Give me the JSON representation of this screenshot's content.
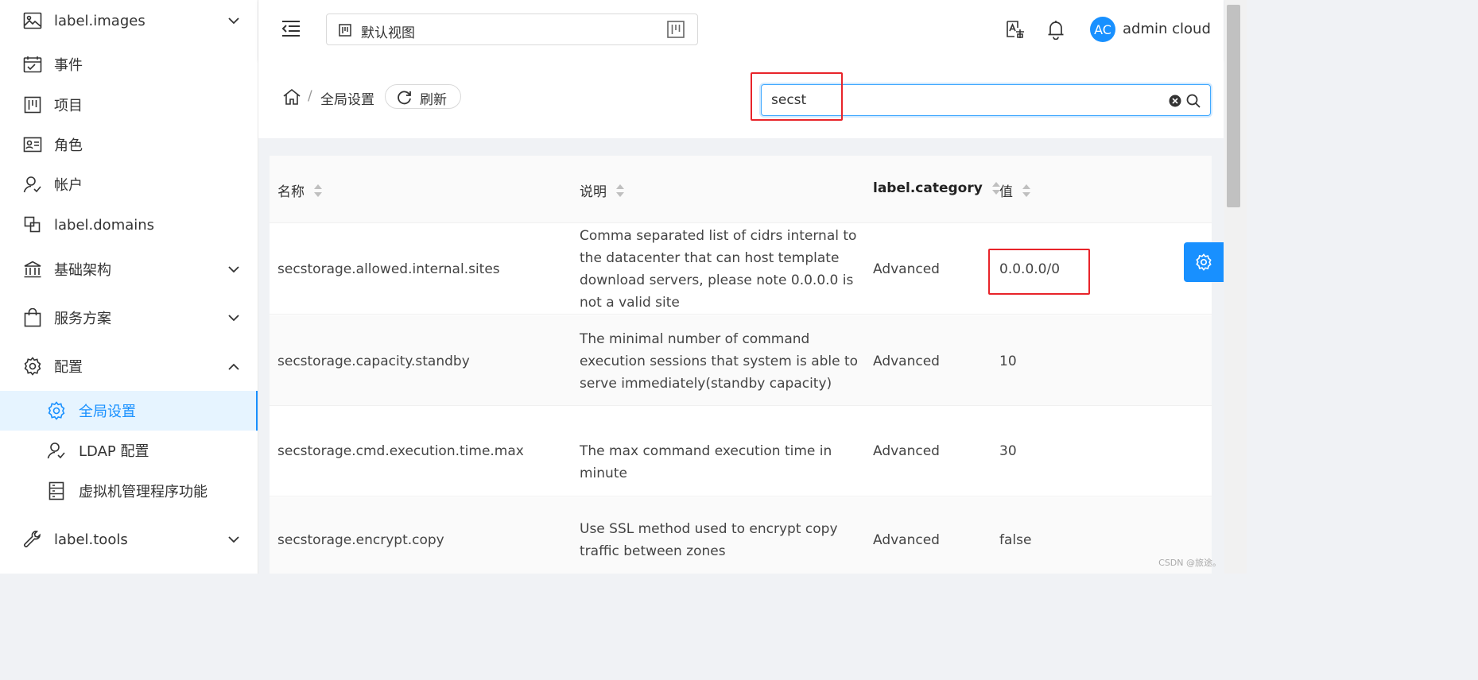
{
  "sidebar": {
    "items": [
      {
        "label": "label.images",
        "icon": "image-icon",
        "expandable": true,
        "expanded": false
      },
      {
        "label": "事件",
        "icon": "calendar-icon"
      },
      {
        "label": "项目",
        "icon": "project-icon"
      },
      {
        "label": "角色",
        "icon": "idcard-icon"
      },
      {
        "label": "帐户",
        "icon": "user-icon"
      },
      {
        "label": "label.domains",
        "icon": "block-icon"
      },
      {
        "label": "基础架构",
        "icon": "bank-icon",
        "expandable": true,
        "expanded": false
      },
      {
        "label": "服务方案",
        "icon": "shopping-icon",
        "expandable": true,
        "expanded": false
      },
      {
        "label": "配置",
        "icon": "setting-icon",
        "expandable": true,
        "expanded": true
      },
      {
        "label": "全局设置",
        "icon": "setting-icon",
        "sub": true,
        "active": true
      },
      {
        "label": "LDAP 配置",
        "icon": "user-icon",
        "sub": true
      },
      {
        "label": "虚拟机管理程序功能",
        "icon": "database-icon",
        "sub": true
      },
      {
        "label": "label.tools",
        "icon": "tool-icon",
        "expandable": true,
        "expanded": false
      }
    ]
  },
  "header": {
    "view_label": "默认视图",
    "user": {
      "initials": "AC",
      "name": "admin cloud"
    }
  },
  "breadcrumb": {
    "current": "全局设置",
    "separator": "/",
    "refresh_label": "刷新"
  },
  "search": {
    "value": "secst"
  },
  "table": {
    "columns": [
      {
        "label": "名称",
        "bold": false
      },
      {
        "label": "说明",
        "bold": false
      },
      {
        "label": "label.category",
        "bold": true
      },
      {
        "label": "值",
        "bold": false
      }
    ],
    "rows": [
      {
        "name": "secstorage.allowed.internal.sites",
        "description": "Comma separated list of cidrs internal to the datacenter that can host template download servers, please note 0.0.0.0 is not a valid site",
        "category": "Advanced",
        "value": "0.0.0.0/0"
      },
      {
        "name": "secstorage.capacity.standby",
        "description": "The minimal number of command execution sessions that system is able to serve immediately(standby capacity)",
        "category": "Advanced",
        "value": "10"
      },
      {
        "name": "secstorage.cmd.execution.time.max",
        "description": "The max command execution time in minute",
        "category": "Advanced",
        "value": "30"
      },
      {
        "name": "secstorage.encrypt.copy",
        "description": "Use SSL method used to encrypt copy traffic between zones",
        "category": "Advanced",
        "value": "false"
      }
    ]
  },
  "watermark": "CSDN @旅途。",
  "colors": {
    "primary": "#1890ff",
    "annotation_red": "#e8242a",
    "active_bg": "#e6f4ff"
  }
}
